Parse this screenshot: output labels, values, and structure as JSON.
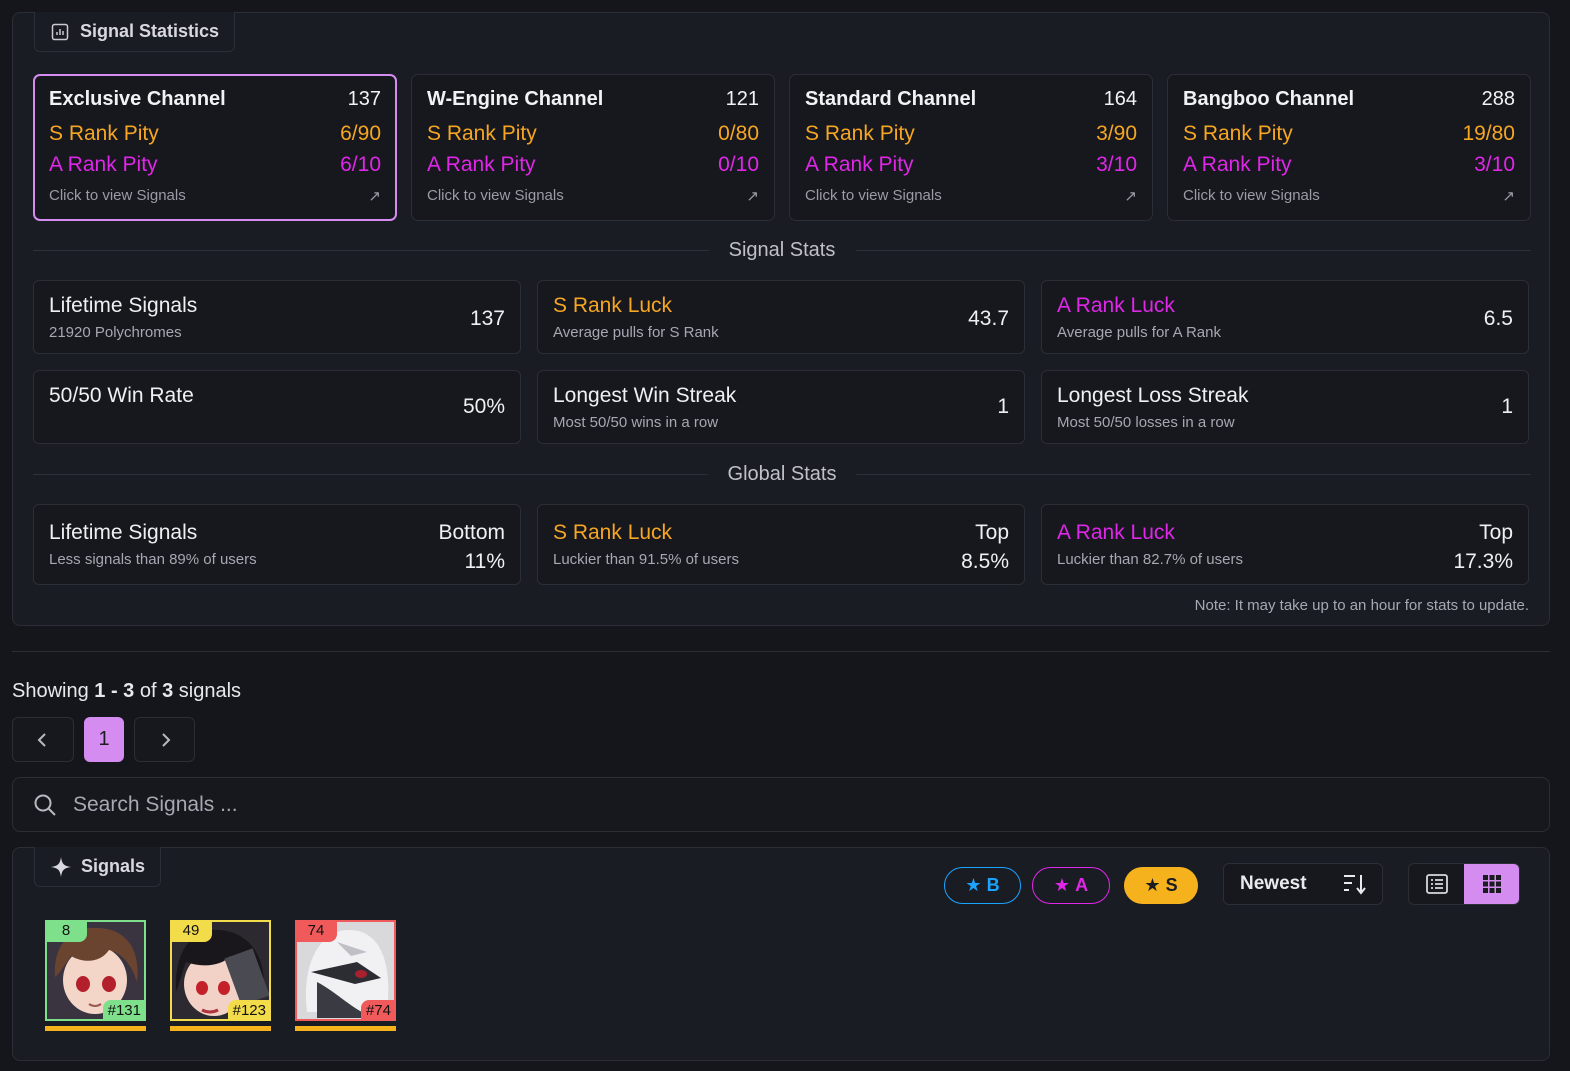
{
  "stats_panel": {
    "tab_label": "Signal Statistics",
    "channels": [
      {
        "name": "Exclusive Channel",
        "count": "137",
        "s_label": "S Rank Pity",
        "s_value": "6/90",
        "a_label": "A Rank Pity",
        "a_value": "6/10",
        "footer": "Click to view Signals",
        "active": true
      },
      {
        "name": "W-Engine Channel",
        "count": "121",
        "s_label": "S Rank Pity",
        "s_value": "0/80",
        "a_label": "A Rank Pity",
        "a_value": "0/10",
        "footer": "Click to view Signals",
        "active": false
      },
      {
        "name": "Standard Channel",
        "count": "164",
        "s_label": "S Rank Pity",
        "s_value": "3/90",
        "a_label": "A Rank Pity",
        "a_value": "3/10",
        "footer": "Click to view Signals",
        "active": false
      },
      {
        "name": "Bangboo Channel",
        "count": "288",
        "s_label": "S Rank Pity",
        "s_value": "19/80",
        "a_label": "A Rank Pity",
        "a_value": "3/10",
        "footer": "Click to view Signals",
        "active": false
      }
    ],
    "signal_stats_title": "Signal Stats",
    "signal_stats": [
      {
        "title": "Lifetime Signals",
        "sub": "21920 Polychromes",
        "value": "137",
        "color": "white"
      },
      {
        "title": "S Rank Luck",
        "sub": "Average pulls for S Rank",
        "value": "43.7",
        "color": "orange"
      },
      {
        "title": "A Rank Luck",
        "sub": "Average pulls for A Rank",
        "value": "6.5",
        "color": "magenta"
      },
      {
        "title": "50/50 Win Rate",
        "sub": "",
        "value": "50%",
        "color": "white"
      },
      {
        "title": "Longest Win Streak",
        "sub": "Most 50/50 wins in a row",
        "value": "1",
        "color": "white"
      },
      {
        "title": "Longest Loss Streak",
        "sub": "Most 50/50 losses in a row",
        "value": "1",
        "color": "white"
      }
    ],
    "global_stats_title": "Global Stats",
    "global_stats": [
      {
        "title": "Lifetime Signals",
        "sub": "Less signals than 89% of users",
        "rank": "Bottom",
        "value": "11%",
        "color": "white"
      },
      {
        "title": "S Rank Luck",
        "sub": "Luckier than 91.5% of users",
        "rank": "Top",
        "value": "8.5%",
        "color": "orange"
      },
      {
        "title": "A Rank Luck",
        "sub": "Luckier than 82.7% of users",
        "rank": "Top",
        "value": "17.3%",
        "color": "magenta"
      }
    ],
    "note": "Note: It may take up to an hour for stats to update."
  },
  "listing": {
    "showing_prefix": "Showing ",
    "range": "1 - 3",
    "of": " of ",
    "total": "3",
    "suffix": " signals",
    "current_page": "1"
  },
  "search": {
    "placeholder": "Search Signals ..."
  },
  "signals_panel": {
    "tab_label": "Signals",
    "filters": [
      {
        "label": "B",
        "color": "#1aa3ff"
      },
      {
        "label": "A",
        "color": "#e026e8"
      },
      {
        "label": "S",
        "color": "#f6b21c"
      }
    ],
    "sort_label": "Newest",
    "items": [
      {
        "level": "8",
        "number": "#131",
        "frame_color": "#7ee08a",
        "icon": "agent-portrait-brown-hair"
      },
      {
        "level": "49",
        "number": "#123",
        "frame_color": "#f3dc4a",
        "icon": "agent-portrait-black-hair"
      },
      {
        "level": "74",
        "number": "#74",
        "frame_color": "#f05a5a",
        "icon": "agent-portrait-white-mask"
      }
    ]
  },
  "colors": {
    "accent": "#d58cf0",
    "s_rank": "#f6a623",
    "a_rank": "#e026e8",
    "background": "#14161c"
  }
}
